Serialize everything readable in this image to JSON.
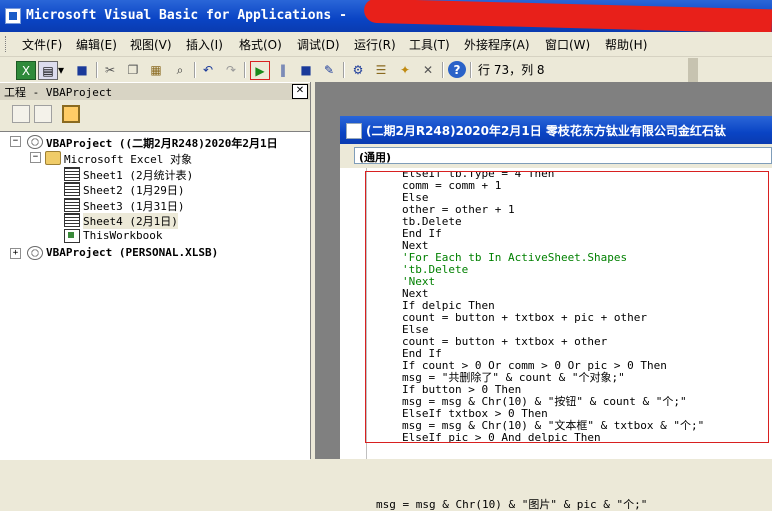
{
  "window": {
    "title": "Microsoft Visual Basic for Applications - "
  },
  "menubar": {
    "items": [
      "文件(F)",
      "编辑(E)",
      "视图(V)",
      "插入(I)",
      "格式(O)",
      "调试(D)",
      "运行(R)",
      "工具(T)",
      "外接程序(A)",
      "窗口(W)",
      "帮助(H)"
    ]
  },
  "toolbar": {
    "status": "行 73，列 8"
  },
  "project_pane": {
    "title": "工程 - VBAProject",
    "tree": {
      "project1": "VBAProject ((二期2月R248)2020年2月1日",
      "folder": "Microsoft Excel 对象",
      "sheets": [
        "Sheet1 (2月统计表)",
        "Sheet2 (1月29日)",
        "Sheet3 (1月31日)",
        "Sheet4 (2月1日)",
        "ThisWorkbook"
      ],
      "project2": "VBAProject (PERSONAL.XLSB)"
    }
  },
  "code_window": {
    "title": "(二期2月R248)2020年2月1日 零枝花东方钛业有限公司金红石钛",
    "object_combo": "(通用)",
    "lines": [
      "ElseIf tb.Type = 4 Then",
      "comm = comm + 1",
      "Else",
      "other = other + 1",
      "tb.Delete",
      "End If",
      "Next",
      "'For Each tb In ActiveSheet.Shapes",
      "'tb.Delete",
      "'Next",
      "Next",
      "If delpic Then",
      "count = button + txtbox + pic + other",
      "Else",
      "count = button + txtbox + other",
      "End If",
      "If count > 0 Or comm > 0 Or pic > 0 Then",
      "msg = \"共删除了\" & count & \"个对象;\"",
      "If button > 0 Then",
      "msg = msg & Chr(10) & \"按钮\" & count & \"个;\"",
      "ElseIf txtbox > 0 Then",
      "msg = msg & Chr(10) & \"文本框\" & txtbox & \"个;\"",
      "ElseIf pic > 0 And delpic Then"
    ],
    "last_line": "msg = msg & Chr(10) & \"图片\" & pic & \"个;\""
  }
}
